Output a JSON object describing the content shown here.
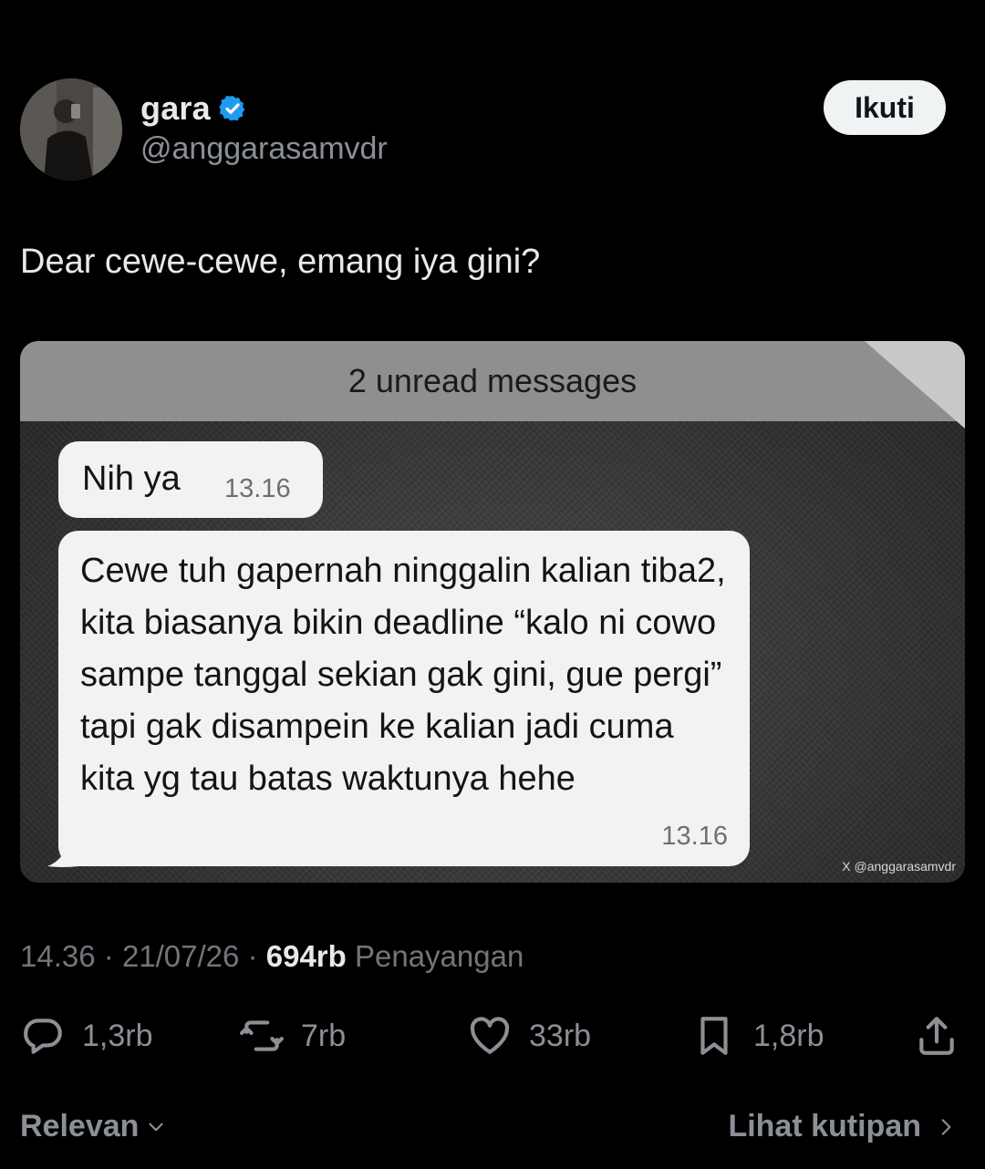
{
  "author": {
    "name": "gara",
    "handle": "@anggarasamvdr",
    "verified_icon": "verified-badge-icon"
  },
  "follow_label": "Ikuti",
  "tweet": {
    "text": "Dear cewe-cewe, emang iya gini?"
  },
  "media": {
    "unread_banner": "2 unread messages",
    "messages": [
      {
        "text": "Nih ya",
        "time": "13.16"
      },
      {
        "text": "Cewe tuh gapernah ninggalin kalian tiba2, kita biasanya bikin deadline “kalo ni cowo sampe tanggal sekian gak gini, gue pergi” tapi gak disampein ke kalian jadi cuma kita yg tau batas waktunya hehe",
        "time": "13.16"
      }
    ],
    "watermark": "X @anggarasamvdr"
  },
  "meta": {
    "time": "14.36",
    "date": "21/07/26",
    "views_count": "694rb",
    "views_label": "Penayangan",
    "separator": "·"
  },
  "actions": {
    "replies": "1,3rb",
    "reposts": "7rb",
    "likes": "33rb",
    "bookmarks": "1,8rb"
  },
  "footer": {
    "sort_label": "Relevan",
    "quotes_label": "Lihat kutipan"
  },
  "colors": {
    "background": "#000000",
    "verified": "#1d9bf0",
    "muted": "#71767b"
  }
}
